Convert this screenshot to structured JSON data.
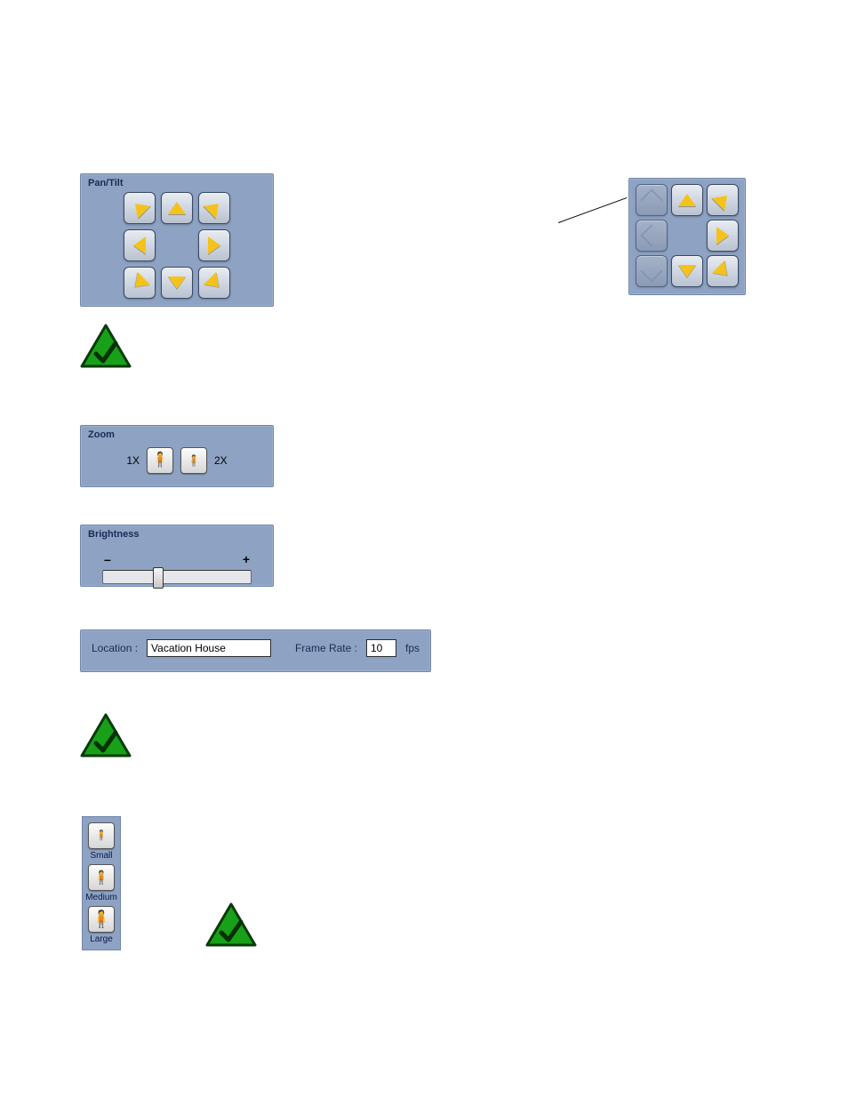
{
  "pantilt": {
    "title": "Pan/Tilt"
  },
  "zoom": {
    "title": "Zoom",
    "label_1x": "1X",
    "label_2x": "2X"
  },
  "brightness": {
    "title": "Brightness",
    "minus": "–",
    "plus": "+"
  },
  "location": {
    "label": "Location :",
    "value": "Vacation House"
  },
  "frame_rate": {
    "label": "Frame Rate :",
    "value": "10",
    "unit": "fps"
  },
  "size": {
    "small": "Small",
    "medium": "Medium",
    "large": "Large"
  },
  "icons": {
    "person": "🚶",
    "person_small": "🧍"
  }
}
